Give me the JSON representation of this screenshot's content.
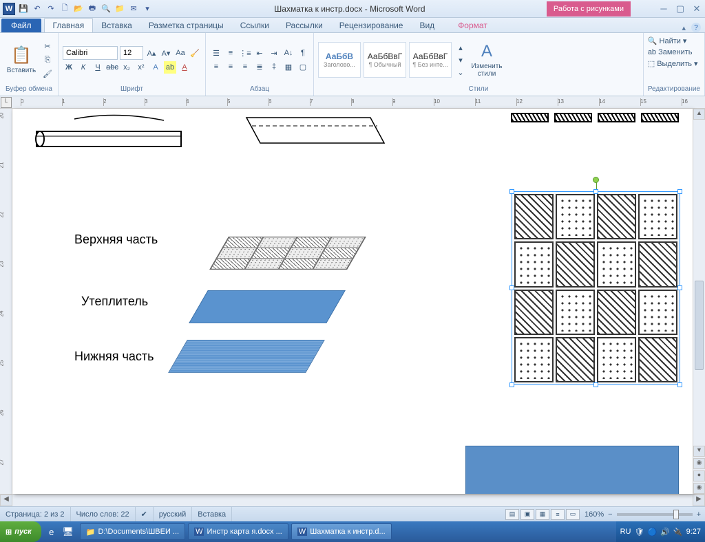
{
  "titlebar": {
    "doc_title": "Шахматка к инстр.docx - Microsoft Word",
    "pic_tools": "Работа с рисунками"
  },
  "tabs": {
    "file": "Файл",
    "home": "Главная",
    "insert": "Вставка",
    "layout": "Разметка страницы",
    "refs": "Ссылки",
    "mail": "Рассылки",
    "review": "Рецензирование",
    "view": "Вид",
    "format": "Формат"
  },
  "ribbon": {
    "clipboard": {
      "label": "Буфер обмена",
      "paste": "Вставить"
    },
    "font": {
      "label": "Шрифт",
      "name": "Calibri",
      "size": "12"
    },
    "paragraph": {
      "label": "Абзац"
    },
    "styles": {
      "label": "Стили",
      "s1_sample": "АаБбВ",
      "s1_name": "Заголово...",
      "s2_sample": "АаБбВвГ",
      "s2_name": "¶ Обычный",
      "s3_sample": "АаБбВвГ",
      "s3_name": "¶ Без инте...",
      "change": "Изменить стили"
    },
    "editing": {
      "label": "Редактирование",
      "find": "Найти",
      "replace": "Заменить",
      "select": "Выделить"
    }
  },
  "document": {
    "label_top": "Верхняя часть",
    "label_mid": "Утеплитель",
    "label_bot": "Нижняя часть"
  },
  "status": {
    "page": "Страница: 2 из 2",
    "words": "Число слов: 22",
    "lang": "русский",
    "mode": "Вставка",
    "zoom": "160%"
  },
  "taskbar": {
    "start": "пуск",
    "t1": "D:\\Documents\\ШВЕИ ...",
    "t2": "Инстр карта я.docx ...",
    "t3": "Шахматка к инстр.d...",
    "lang": "RU",
    "time": "9:27"
  }
}
